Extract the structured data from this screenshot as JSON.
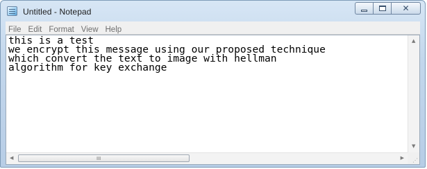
{
  "window": {
    "title": "Untitled - Notepad",
    "app_icon": "notepad-icon",
    "controls": {
      "minimize_icon": "minimize-icon",
      "maximize_icon": "maximize-icon",
      "close_icon": "close-icon",
      "close_glyph": "✕"
    }
  },
  "menu": {
    "items": [
      {
        "label": "File"
      },
      {
        "label": "Edit"
      },
      {
        "label": "Format"
      },
      {
        "label": "View"
      },
      {
        "label": "Help"
      }
    ]
  },
  "editor": {
    "content": "this is a test\nwe encrypt this message using our proposed technique\nwhich convert the text to image with hellman\nalgorithm for key exchange"
  },
  "scrollbars": {
    "up_arrow": "▲",
    "down_arrow": "▼",
    "left_arrow": "◀",
    "right_arrow": "▶",
    "thumb_grip": "III"
  }
}
